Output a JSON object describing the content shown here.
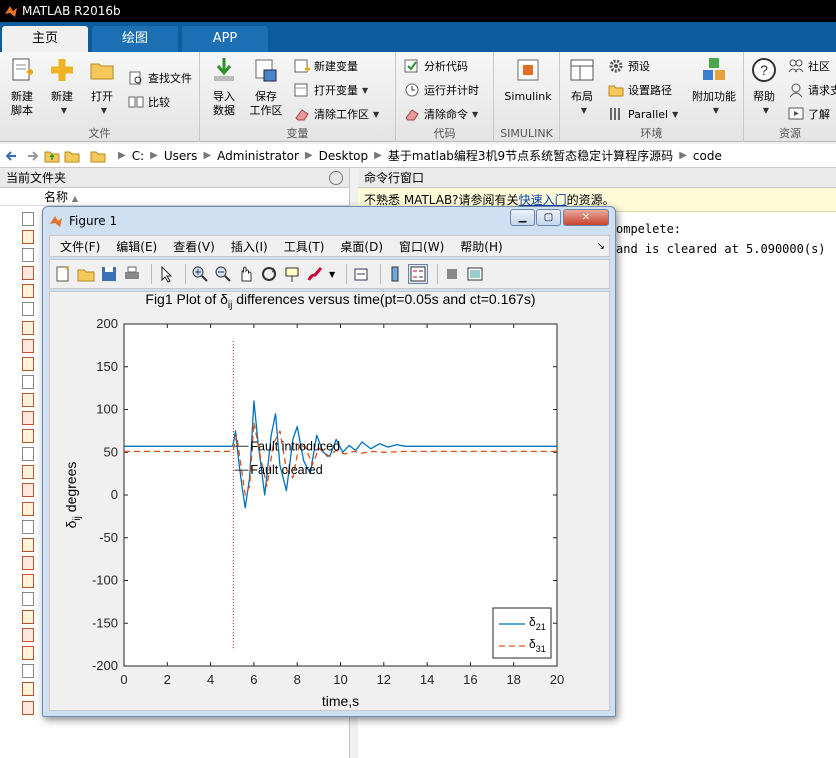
{
  "window": {
    "title": "MATLAB R2016b"
  },
  "tabs": [
    {
      "label": "主页",
      "active": true
    },
    {
      "label": "绘图",
      "active": false
    },
    {
      "label": "APP",
      "active": false
    }
  ],
  "ribbon": {
    "file": {
      "label": "文件",
      "new_script": "新建\n脚本",
      "new_script_l1": "新建",
      "new_script_l2": "脚本",
      "new": "新建",
      "open": "打开",
      "find_files": "查找文件",
      "compare": "比较"
    },
    "variable": {
      "label": "变量",
      "import_l1": "导入",
      "import_l2": "数据",
      "save_l1": "保存",
      "save_l2": "工作区",
      "new_variable": "新建变量",
      "open_variable": "打开变量",
      "clear_workspace": "清除工作区"
    },
    "code": {
      "label": "代码",
      "analyze": "分析代码",
      "run_time": "运行并计时",
      "clear_commands": "清除命令"
    },
    "simulink": {
      "label": "SIMULINK",
      "button": "Simulink"
    },
    "environment": {
      "label": "环境",
      "layout": "布局",
      "preferences": "预设",
      "set_path": "设置路径",
      "parallel": "Parallel",
      "addons": "附加功能"
    },
    "resources": {
      "label": "资源",
      "help": "帮助",
      "community": "社区",
      "request": "请求支",
      "learn": "了解"
    }
  },
  "address": {
    "crumbs": [
      "C:",
      "Users",
      "Administrator",
      "Desktop",
      "基于matlab编程3机9节点系统暂态稳定计算程序源码",
      "code"
    ]
  },
  "current_folder": {
    "title": "当前文件夹",
    "column_name": "名称"
  },
  "command_window": {
    "title": "命令行窗口",
    "notice_prefix": "不熟悉 MATLAB?请参阅有关",
    "notice_link": "快速入门",
    "notice_suffix": "的资源。",
    "line1": "ompelete:",
    "line2": "and is cleared at 5.090000(s)"
  },
  "figure": {
    "title": "Figure 1",
    "menu": [
      "文件(F)",
      "编辑(E)",
      "查看(V)",
      "插入(I)",
      "工具(T)",
      "桌面(D)",
      "窗口(W)",
      "帮助(H)"
    ]
  },
  "colors": {
    "matlab_blue": "#0d5c9e",
    "series1": "#0072bd",
    "series2": "#d95319",
    "fault_line": "#a2142f"
  },
  "chart_data": {
    "type": "line",
    "title_prefix": "Fig1 Plot of ",
    "title_symbol": "δ",
    "title_sub": "ij",
    "title_suffix": " differences versus time(pt=0.05s and ct=0.167s)",
    "xlabel": "time,s",
    "ylabel_symbol": "δ",
    "ylabel_sub": "ij",
    "ylabel_suffix": " degrees",
    "xlim": [
      0,
      20
    ],
    "ylim": [
      -200,
      200
    ],
    "xticks": [
      0,
      2,
      4,
      6,
      8,
      10,
      12,
      14,
      16,
      18,
      20
    ],
    "yticks": [
      200,
      150,
      100,
      50,
      0,
      -50,
      -100,
      -150,
      -200
    ],
    "annotations": [
      {
        "text": "Fault introduced",
        "x": 5.1,
        "y": 57
      },
      {
        "text": "Fault cleared",
        "x": 5.1,
        "y": 29
      }
    ],
    "fault_time": 5.05,
    "legend": {
      "placement": "bottom-right",
      "entries": [
        {
          "symbol": "δ",
          "sub": "21",
          "style": "solid"
        },
        {
          "symbol": "δ",
          "sub": "31",
          "style": "dashed"
        }
      ]
    },
    "series": [
      {
        "name": "δ21",
        "x": [
          0,
          5.0,
          5.05,
          5.15,
          5.3,
          5.45,
          5.6,
          5.8,
          6.0,
          6.2,
          6.5,
          6.8,
          7.0,
          7.2,
          7.5,
          7.8,
          8.0,
          8.3,
          8.6,
          8.9,
          9.2,
          9.5,
          9.8,
          10.1,
          10.4,
          10.7,
          11.0,
          11.4,
          11.8,
          12.2,
          12.6,
          13.0,
          14.0,
          20
        ],
        "values": [
          57,
          57,
          60,
          75,
          40,
          10,
          -15,
          20,
          110,
          60,
          0,
          70,
          95,
          35,
          5,
          65,
          80,
          40,
          25,
          70,
          50,
          45,
          65,
          50,
          58,
          52,
          62,
          54,
          60,
          56,
          59,
          57,
          57,
          57
        ]
      },
      {
        "name": "δ31",
        "x": [
          0,
          5.0,
          5.05,
          5.2,
          5.4,
          5.6,
          5.8,
          6.0,
          6.3,
          6.6,
          6.9,
          7.2,
          7.5,
          7.8,
          8.1,
          8.4,
          8.7,
          9.0,
          9.4,
          9.8,
          10.2,
          10.6,
          11.0,
          11.5,
          12.0,
          13.0,
          20
        ],
        "values": [
          51,
          51,
          53,
          70,
          35,
          0,
          10,
          85,
          45,
          10,
          60,
          75,
          30,
          20,
          60,
          55,
          35,
          55,
          45,
          52,
          48,
          51,
          49,
          51,
          50,
          51,
          51
        ]
      }
    ]
  }
}
